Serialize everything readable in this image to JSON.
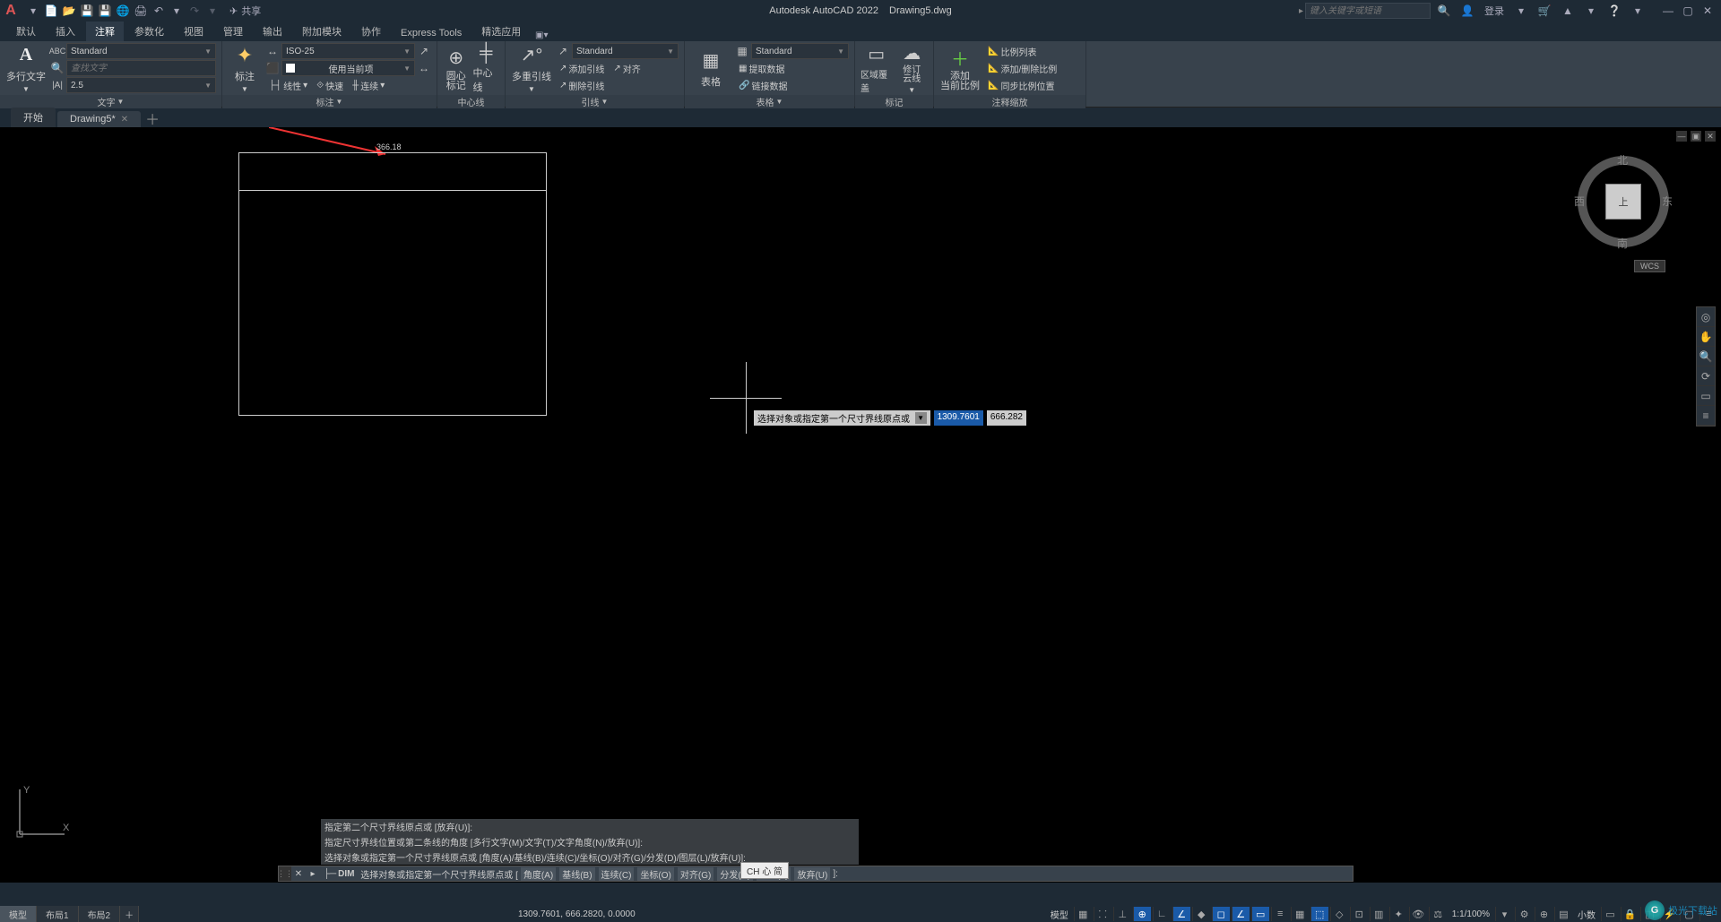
{
  "title": {
    "app": "Autodesk AutoCAD 2022",
    "file": "Drawing5.dwg"
  },
  "qat": {
    "share": "共享"
  },
  "search": {
    "placeholder": "键入关键字或短语"
  },
  "login": {
    "label": "登录"
  },
  "menu": {
    "tabs": [
      "默认",
      "插入",
      "注释",
      "参数化",
      "视图",
      "管理",
      "输出",
      "附加模块",
      "协作",
      "Express Tools",
      "精选应用"
    ],
    "active_index": 2
  },
  "ribbon": {
    "text_panel": {
      "big_button": "多行文字",
      "style_combo": "Standard",
      "find_placeholder": "查找文字",
      "height": "2.5",
      "title": "文字"
    },
    "dim_panel": {
      "big_button": "标注",
      "style_combo": "ISO-25",
      "layer_combo": "使用当前项",
      "sub1": "线性",
      "sub2": "快速",
      "sub3": "连续",
      "title": "标注"
    },
    "centerline_panel": {
      "btn1": "圆心\n标记",
      "btn2": "中心线",
      "title": "中心线"
    },
    "leader_panel": {
      "big_button": "多重引线",
      "style_combo": "Standard",
      "r1": "添加引线",
      "r2": "删除引线",
      "r3": "对齐",
      "title": "引线"
    },
    "table_panel": {
      "big_button": "表格",
      "style_combo": "Standard",
      "r1": "提取数据",
      "r2": "链接数据",
      "title": "表格"
    },
    "markup_panel": {
      "b1": "区域覆盖",
      "b2": "修订\n云线",
      "title": "标记"
    },
    "scale_panel": {
      "big_button": "添加\n当前比例",
      "r1": "比例列表",
      "r2": "添加/删除比例",
      "r3": "同步比例位置",
      "title": "注释缩放"
    }
  },
  "file_tabs": {
    "start": "开始",
    "drawing": "Drawing5*"
  },
  "drawing": {
    "dim_value": "366.18"
  },
  "dyn_input": {
    "prompt": "选择对象或指定第一个尺寸界线原点或",
    "coord1": "1309.7601",
    "coord2": "666.282"
  },
  "viewcube": {
    "top": "上",
    "n": "北",
    "s": "南",
    "e": "东",
    "w": "西",
    "wcs": "WCS"
  },
  "cmd_history": {
    "l1": "指定第二个尺寸界线原点或 [放弃(U)]:",
    "l2": "指定尺寸界线位置或第二条线的角度 [多行文字(M)/文字(T)/文字角度(N)/放弃(U)]:",
    "l3": "选择对象或指定第一个尺寸界线原点或 [角度(A)/基线(B)/连续(C)/坐标(O)/对齐(G)/分发(D)/图层(L)/放弃(U)]:"
  },
  "cmd_line": {
    "cmd": "DIM",
    "prompt": "选择对象或指定第一个尺寸界线原点或 [",
    "opts": [
      "角度(A)",
      "基线(B)",
      "连续(C)",
      "坐标(O)",
      "对齐(G)",
      "分发(D)",
      "图层(L)",
      "放弃(U)"
    ],
    "close": "]:"
  },
  "ime": {
    "label": "CH 心 简"
  },
  "layout_tabs": {
    "model": "模型",
    "l1": "布局1",
    "l2": "布局2"
  },
  "status": {
    "coords": "1309.7601, 666.2820, 0.0000",
    "model": "模型",
    "scale": "1:1/100%",
    "decimal": "小数"
  },
  "watermark": {
    "text": "极光下载站"
  }
}
